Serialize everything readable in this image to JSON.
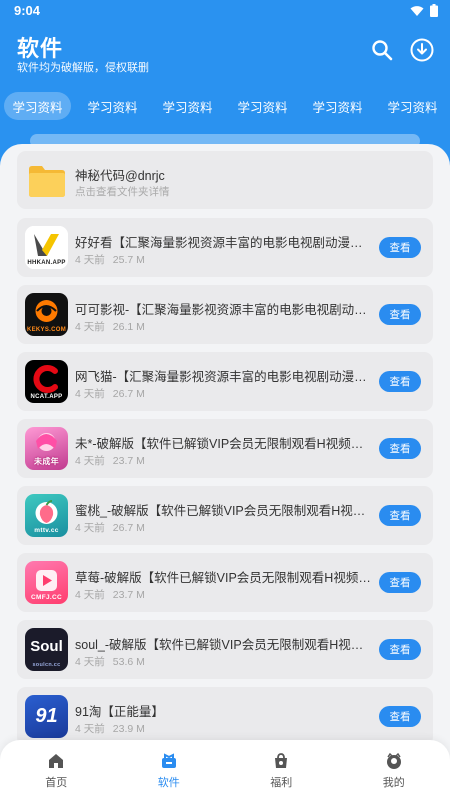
{
  "status": {
    "time": "9:04"
  },
  "header": {
    "title": "软件",
    "subtitle": "软件均为破解版，侵权联删",
    "search_icon": "search-icon",
    "download_icon": "download-icon"
  },
  "tabs": [
    {
      "label": "学习资料",
      "active": true
    },
    {
      "label": "学习资料"
    },
    {
      "label": "学习资料"
    },
    {
      "label": "学习资料"
    },
    {
      "label": "学习资料"
    },
    {
      "label": "学习资料"
    }
  ],
  "folder": {
    "name": "神秘代码@dnrjc",
    "hint": "点击查看文件夹详情"
  },
  "view_label": "查看",
  "apps": [
    {
      "title": "好好看【汇聚海量影视资源丰富的电影电视剧动漫等内…",
      "time": "4 天前",
      "size": "25.7 M",
      "icon_text": "HHKAN.APP"
    },
    {
      "title": "可可影视-【汇聚海量影视资源丰富的电影电视剧动漫等…",
      "time": "4 天前",
      "size": "26.1 M",
      "icon_text": "KEKYS.COM"
    },
    {
      "title": "网飞猫-【汇聚海量影视资源丰富的电影电视剧动漫等内…",
      "time": "4 天前",
      "size": "26.7 M",
      "icon_text": "NCAT.APP"
    },
    {
      "title": "未*-破解版【软件已解锁VIP会员无限制观看H视频请勿…",
      "time": "4 天前",
      "size": "23.7 M",
      "icon_text": "未成年"
    },
    {
      "title": "蜜桃_-破解版【软件已解锁VIP会员无限制观看H视频请…",
      "time": "4 天前",
      "size": "26.7 M",
      "icon_text": "mttv.cc"
    },
    {
      "title": "草莓-破解版【软件已解锁VIP会员无限制观看H视频请勿…",
      "time": "4 天前",
      "size": "23.7 M",
      "icon_text": "CMFJ.CC"
    },
    {
      "title": "soul_-破解版【软件已解锁VIP会员无限制观看H视频请…",
      "time": "4 天前",
      "size": "53.6 M",
      "icon_text": "Soul"
    },
    {
      "title": "91淘【正能量】",
      "time": "4 天前",
      "size": "23.9 M",
      "icon_text": "91"
    }
  ],
  "nav": [
    {
      "label": "首页",
      "icon": "home-icon"
    },
    {
      "label": "软件",
      "icon": "apps-icon",
      "active": true
    },
    {
      "label": "福利",
      "icon": "gift-bag-icon"
    },
    {
      "label": "我的",
      "icon": "profile-icon"
    }
  ]
}
